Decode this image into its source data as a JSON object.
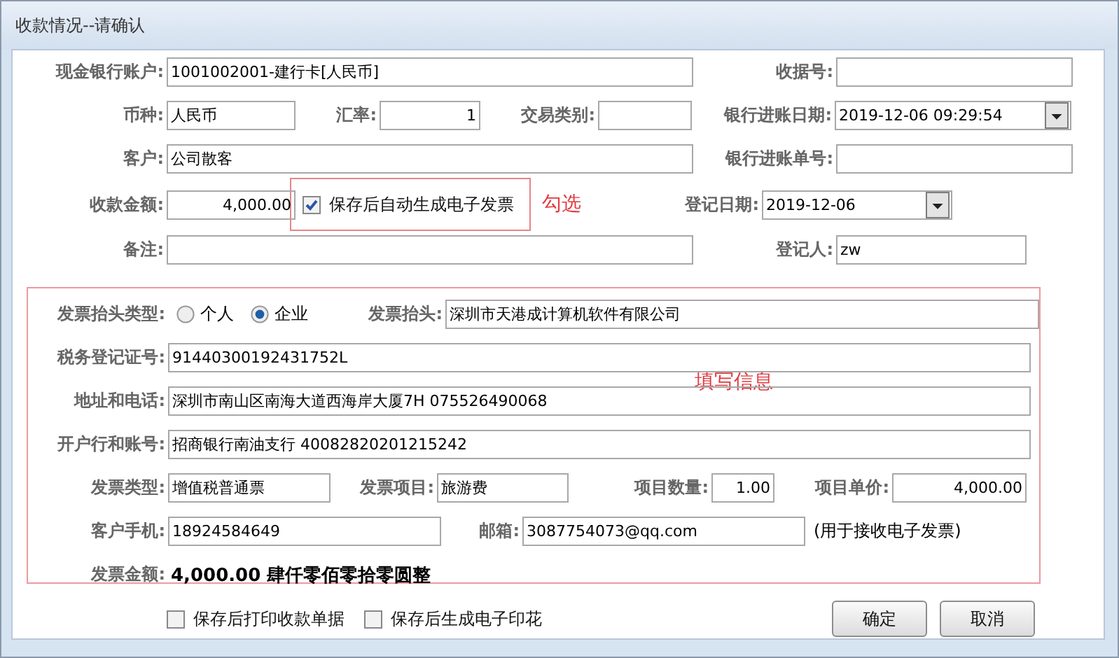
{
  "window": {
    "title": "收款情况--请确认"
  },
  "payment": {
    "cash_account": {
      "label": "现金银行账户:",
      "value": "1001002001-建行卡[人民币]"
    },
    "receipt_no": {
      "label": "收据号:"
    },
    "currency": {
      "label": "币种:",
      "value": "人民币"
    },
    "exchange_rate": {
      "label": "汇率:",
      "value": "1"
    },
    "transaction_type": {
      "label": "交易类别:"
    },
    "bank_date": {
      "label": "银行进账日期:",
      "value": "2019-12-06 09:29:54"
    },
    "customer": {
      "label": "客户:",
      "value": "公司散客"
    },
    "bank_slip_no": {
      "label": "银行进账单号:"
    },
    "amount": {
      "label": "收款金额:",
      "value": "4,000.00"
    },
    "auto_invoice": {
      "label": "保存后自动生成电子发票",
      "checked": true
    },
    "register_date": {
      "label": "登记日期:",
      "value": "2019-12-06"
    },
    "remark": {
      "label": "备注:"
    },
    "registrar": {
      "label": "登记人:",
      "value": "zw"
    }
  },
  "annotations": [
    {
      "text": "勾选"
    },
    {
      "text": "填写信息"
    }
  ],
  "invoice": {
    "title_type": {
      "label": "发票抬头类型:",
      "options": [
        {
          "label": "个人",
          "selected": false
        },
        {
          "label": "企业",
          "selected": true
        }
      ]
    },
    "title": {
      "label": "发票抬头:",
      "value": "深圳市天港成计算机软件有限公司"
    },
    "tax_id": {
      "label": "税务登记证号:",
      "value": "91440300192431752L"
    },
    "address_phone": {
      "label": "地址和电话:",
      "value": "深圳市南山区南海大道西海岸大厦7H 075526490068"
    },
    "bank_account": {
      "label": "开户行和账号:",
      "value": "招商银行南油支行 40082820201215242"
    },
    "invoice_type": {
      "label": "发票类型:",
      "value": "增值税普通票"
    },
    "item": {
      "label": "发票项目:",
      "value": "旅游费"
    },
    "quantity": {
      "label": "项目数量:",
      "value": "1.00"
    },
    "unit_price": {
      "label": "项目单价:",
      "value": "4,000.00"
    },
    "mobile": {
      "label": "客户手机:",
      "value": "18924584649"
    },
    "email": {
      "label": "邮箱:",
      "value": "3087754073@qq.com"
    },
    "email_note": "(用于接收电子发票)",
    "total": {
      "label": "发票金额:",
      "value": "4,000.00 肆仟零佰零拾零圆整"
    }
  },
  "options": [
    {
      "label": "保存后打印收款单据",
      "checked": false
    },
    {
      "label": "保存后生成电子印花",
      "checked": false
    }
  ],
  "buttons": [
    "确定",
    "取消"
  ]
}
